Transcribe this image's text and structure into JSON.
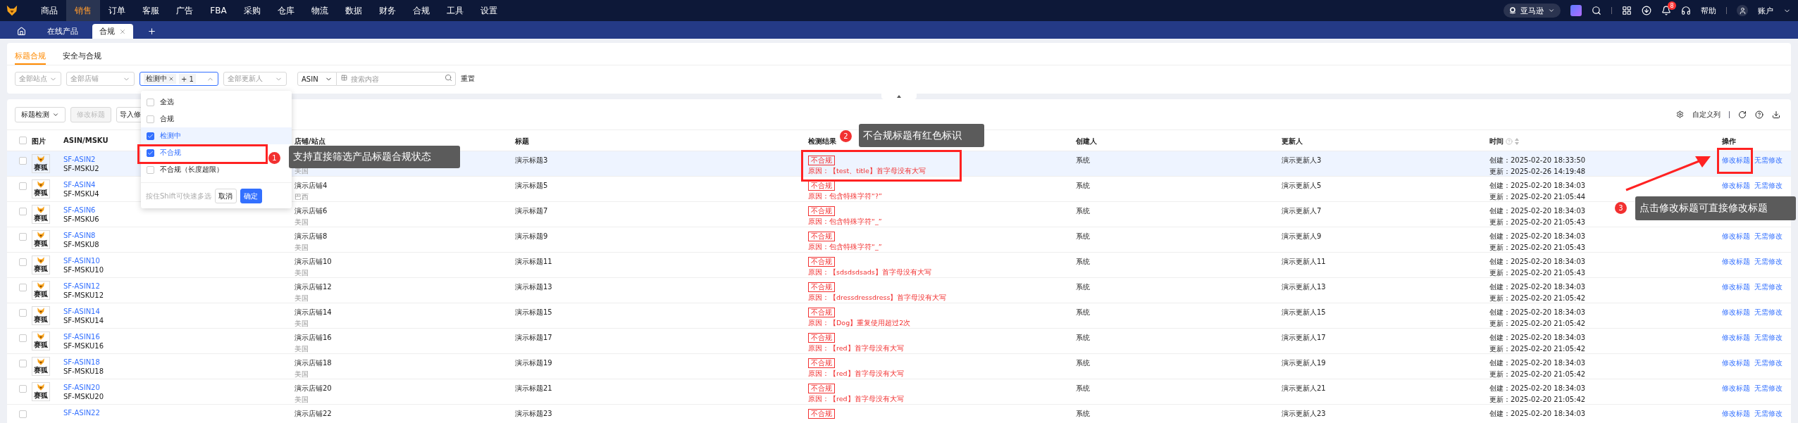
{
  "nav": {
    "items": [
      {
        "label": "商品",
        "selected": false
      },
      {
        "label": "销售",
        "selected": true
      },
      {
        "label": "订单",
        "selected": false
      },
      {
        "label": "客服",
        "selected": false
      },
      {
        "label": "广告",
        "selected": false
      },
      {
        "label": "FBA",
        "selected": false
      },
      {
        "label": "采购",
        "selected": false
      },
      {
        "label": "仓库",
        "selected": false
      },
      {
        "label": "物流",
        "selected": false
      },
      {
        "label": "数据",
        "selected": false
      },
      {
        "label": "财务",
        "selected": false
      },
      {
        "label": "合规",
        "selected": false
      },
      {
        "label": "工具",
        "selected": false
      },
      {
        "label": "设置",
        "selected": false
      }
    ],
    "platform": "亚马逊",
    "notification_count": "8",
    "help": "帮助",
    "account": "账户"
  },
  "tabs": [
    {
      "label": "在线产品",
      "selected": false
    },
    {
      "label": "合规",
      "selected": true
    }
  ],
  "subtabs": [
    {
      "label": "标题合规",
      "selected": true
    },
    {
      "label": "安全与合规",
      "selected": false
    }
  ],
  "filters": {
    "site": {
      "placeholder": "全部站点"
    },
    "store": {
      "placeholder": "全部店铺"
    },
    "status": {
      "tags": [
        "检测中"
      ],
      "more": "+ 1",
      "open": true
    },
    "updater": {
      "placeholder": "全部更新人"
    },
    "search_type": "ASIN",
    "search": {
      "placeholder": "搜索内容"
    },
    "reset": "重置"
  },
  "dropdown": {
    "options": [
      {
        "label": "全选",
        "checked": false,
        "active": false
      },
      {
        "label": "合规",
        "checked": false,
        "active": false
      },
      {
        "label": "检测中",
        "checked": true,
        "active": true
      },
      {
        "label": "不合规",
        "checked": true,
        "active": false
      },
      {
        "label": "不合规（长度超限）",
        "checked": false,
        "active": false
      }
    ],
    "hint": "按住Shift可快速多选",
    "cancel": "取消",
    "confirm": "确定"
  },
  "toolbar": {
    "buttons": [
      {
        "label": "标题检测",
        "kind": "dropdown",
        "disabled": false
      },
      {
        "label": "修改标题",
        "kind": "plain",
        "disabled": true
      },
      {
        "label": "导入修",
        "kind": "plain",
        "disabled": false
      }
    ],
    "customize": "自定义列"
  },
  "table": {
    "select_all": false,
    "columns": [
      "图片",
      "ASIN/MSKU",
      "店铺/站点",
      "标题",
      "检测结果",
      "创建人",
      "更新人",
      "时间",
      "操作"
    ],
    "rows": [
      {
        "selected": true,
        "checked": false,
        "thumb": "赛狐",
        "asin": "SF-ASIN2",
        "msku": "SF-MSKU2",
        "site": "美国",
        "title": "演示标题3",
        "result": {
          "label": "不合规",
          "kind": "fail"
        },
        "reason": "原因：【test、title】首字母没有大写",
        "creator": "系统",
        "updater": "演示更新人3",
        "created": "创建：2025-02-20 18:33:50",
        "updated": "更新：2025-02-26 14:19:48",
        "actions": [
          "修改标题",
          "无需修改"
        ]
      },
      {
        "selected": false,
        "checked": false,
        "thumb": "赛狐",
        "asin": "SF-ASIN4",
        "msku": "SF-MSKU4",
        "store": "演示店铺4",
        "site": "巴西",
        "title": "演示标题5",
        "result": {
          "label": "不合规",
          "kind": "fail"
        },
        "reason": "原因：包含特殊字符“?”",
        "creator": "系统",
        "updater": "演示更新人5",
        "created": "创建：2025-02-20 18:34:03",
        "updated": "更新：2025-02-20 21:05:44",
        "actions": [
          "修改标题",
          "无需修改"
        ]
      },
      {
        "selected": false,
        "checked": false,
        "thumb": "赛狐",
        "asin": "SF-ASIN6",
        "msku": "SF-MSKU6",
        "store": "演示店铺6",
        "site": "美国",
        "title": "演示标题7",
        "result": {
          "label": "不合规",
          "kind": "fail"
        },
        "reason": "原因：包含特殊字符“_”",
        "creator": "系统",
        "updater": "演示更新人7",
        "created": "创建：2025-02-20 18:34:03",
        "updated": "更新：2025-02-20 21:05:43"
      },
      {
        "selected": false,
        "checked": false,
        "thumb": "赛狐",
        "asin": "SF-ASIN8",
        "msku": "SF-MSKU8",
        "store": "演示店铺8",
        "site": "美国",
        "title": "演示标题9",
        "result": {
          "label": "不合规",
          "kind": "fail"
        },
        "reason": "原因：包含特殊字符“_”",
        "creator": "系统",
        "updater": "演示更新人9",
        "created": "创建：2025-02-20 18:34:03",
        "updated": "更新：2025-02-20 21:05:43",
        "actions": [
          "修改标题",
          "无需修改"
        ]
      },
      {
        "selected": false,
        "checked": false,
        "thumb": "赛狐",
        "asin": "SF-ASIN10",
        "msku": "SF-MSKU10",
        "store": "演示店铺10",
        "site": "美国",
        "title": "演示标题11",
        "result": {
          "label": "不合规",
          "kind": "fail"
        },
        "reason": "原因：【sdsdsdsads】首字母没有大写",
        "creator": "系统",
        "updater": "演示更新人11",
        "created": "创建：2025-02-20 18:34:03",
        "updated": "更新：2025-02-20 21:05:43",
        "actions": [
          "修改标题",
          "无需修改"
        ]
      },
      {
        "selected": false,
        "checked": false,
        "thumb": "赛狐",
        "asin": "SF-ASIN12",
        "msku": "SF-MSKU12",
        "store": "演示店铺12",
        "site": "美国",
        "title": "演示标题13",
        "result": {
          "label": "不合规",
          "kind": "fail"
        },
        "reason": "原因：【dressdressdress】首字母没有大写",
        "creator": "系统",
        "updater": "演示更新人13",
        "created": "创建：2025-02-20 18:34:03",
        "updated": "更新：2025-02-20 21:05:42",
        "actions": [
          "修改标题",
          "无需修改"
        ]
      },
      {
        "selected": false,
        "checked": false,
        "thumb": "赛狐",
        "asin": "SF-ASIN14",
        "msku": "SF-MSKU14",
        "store": "演示店铺14",
        "site": "美国",
        "title": "演示标题15",
        "result": {
          "label": "不合规",
          "kind": "fail"
        },
        "reason": "原因：【Dog】重复使用超过2次",
        "creator": "系统",
        "updater": "演示更新人15",
        "created": "创建：2025-02-20 18:34:03",
        "updated": "更新：2025-02-20 21:05:42",
        "actions": [
          "修改标题",
          "无需修改"
        ]
      },
      {
        "selected": false,
        "checked": false,
        "thumb": "赛狐",
        "asin": "SF-ASIN16",
        "msku": "SF-MSKU16",
        "store": "演示店铺16",
        "site": "美国",
        "title": "演示标题17",
        "result": {
          "label": "不合规",
          "kind": "fail"
        },
        "reason": "原因：【red】首字母没有大写",
        "creator": "系统",
        "updater": "演示更新人17",
        "created": "创建：2025-02-20 18:34:03",
        "updated": "更新：2025-02-20 21:05:42",
        "actions": [
          "修改标题",
          "无需修改"
        ]
      },
      {
        "selected": false,
        "checked": false,
        "thumb": "赛狐",
        "asin": "SF-ASIN18",
        "msku": "SF-MSKU18",
        "store": "演示店铺18",
        "site": "美国",
        "title": "演示标题19",
        "result": {
          "label": "不合规",
          "kind": "fail"
        },
        "reason": "原因：【red】首字母没有大写",
        "creator": "系统",
        "updater": "演示更新人19",
        "created": "创建：2025-02-20 18:34:03",
        "updated": "更新：2025-02-20 21:05:42",
        "actions": [
          "修改标题",
          "无需修改"
        ]
      },
      {
        "selected": false,
        "checked": false,
        "thumb": "赛狐",
        "asin": "SF-ASIN20",
        "msku": "SF-MSKU20",
        "store": "演示店铺20",
        "site": "美国",
        "title": "演示标题21",
        "result": {
          "label": "不合规",
          "kind": "fail"
        },
        "reason": "原因：【red】首字母没有大写",
        "creator": "系统",
        "updater": "演示更新人21",
        "created": "创建：2025-02-20 18:34:03",
        "updated": "更新：2025-02-20 21:05:42",
        "actions": [
          "修改标题",
          "无需修改"
        ]
      },
      {
        "selected": false,
        "checked": false,
        "asin": "SF-ASIN22",
        "store": "演示店铺22",
        "title": "演示标题23",
        "result": {
          "label": "不合规",
          "kind": "fail"
        },
        "creator": "系统",
        "updater": "演示更新人23",
        "created": "创建：2025-02-20 18:34:03",
        "actions": [
          "修改标题",
          "无需修改"
        ]
      }
    ]
  },
  "annotations": [
    {
      "number": "1",
      "text": "支持直接筛选产品标题合规状态"
    },
    {
      "number": "2",
      "text": "不合规标题有红色标识"
    },
    {
      "number": "3",
      "text": "点击修改标题可直接修改标题"
    }
  ]
}
